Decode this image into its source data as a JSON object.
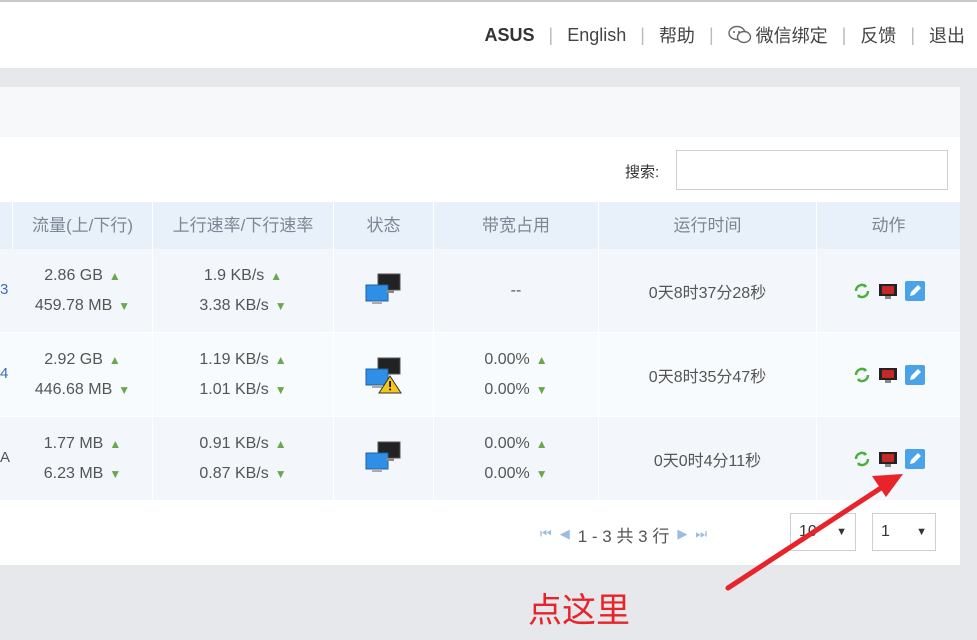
{
  "topbar": {
    "brand": "ASUS",
    "links": [
      "English",
      "帮助",
      "微信绑定",
      "反馈",
      "退出"
    ]
  },
  "search": {
    "label": "搜索:",
    "value": ""
  },
  "table": {
    "columns": [
      "流量(上/下行)",
      "上行速率/下行速率",
      "状态",
      "带宽占用",
      "运行时间",
      "动作"
    ],
    "rows": [
      {
        "left_edge": "3",
        "traffic_up": "2.86 GB",
        "traffic_down": "459.78 MB",
        "rate_up": "1.9 KB/s",
        "rate_down": "3.38 KB/s",
        "status": "network-icon",
        "bandwidth": "--",
        "bandwidth_up": "",
        "bandwidth_down": "",
        "runtime": "0天8时37分28秒"
      },
      {
        "left_edge": "4",
        "traffic_up": "2.92 GB",
        "traffic_down": "446.68 MB",
        "rate_up": "1.19 KB/s",
        "rate_down": "1.01 KB/s",
        "status": "network-warning-icon",
        "bandwidth": "",
        "bandwidth_up": "0.00%",
        "bandwidth_down": "0.00%",
        "runtime": "0天8时35分47秒"
      },
      {
        "left_edge": "A",
        "traffic_up": "1.77 MB",
        "traffic_down": "6.23 MB",
        "rate_up": "0.91 KB/s",
        "rate_down": "0.87 KB/s",
        "status": "network-icon",
        "bandwidth": "",
        "bandwidth_up": "0.00%",
        "bandwidth_down": "0.00%",
        "runtime": "0天0时4分11秒"
      }
    ]
  },
  "pager": {
    "info": "1 - 3 共 3 行",
    "page_size": "10",
    "page": "1"
  },
  "annotation": {
    "text": "点这里",
    "color": "#e8232a"
  },
  "colors": {
    "header_bg": "#e8f1fa",
    "accent_blue": "#3b8fd9",
    "arrow_green": "#6aa84f"
  }
}
